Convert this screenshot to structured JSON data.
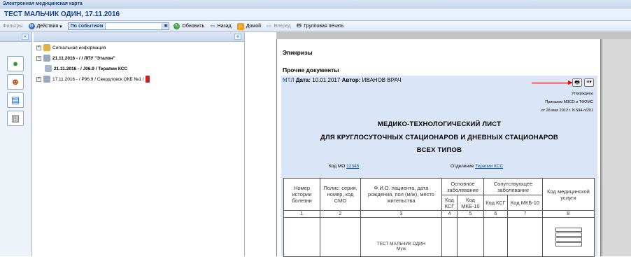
{
  "app": {
    "title": "Электронная медицинская карта",
    "patient_header": "ТЕСТ МАЛЬЧИК ОДИН, 17.11.2016"
  },
  "toolbar": {
    "filters": "Фильтры",
    "actions": "Действия",
    "by_events": "По событиям",
    "refresh": "Обновить",
    "back": "Назад",
    "home": "Домой",
    "forward": "Вперед",
    "group_print": "Групповая печать",
    "collapse": "«"
  },
  "sidebar": {
    "icons": [
      "person-icon",
      "doctors-icon",
      "monitor-icon",
      "book-icon"
    ]
  },
  "tree": {
    "items": [
      {
        "label": "Сигнальная информация"
      },
      {
        "label": "21.11.2016 - / / ЛПУ \"Эталон\""
      },
      {
        "label": "21.11.2016 - / J06.9 / Терапии КСС"
      },
      {
        "label": "17.11.2016 - / P96.9 / Свердловск ОКБ №1 /"
      }
    ]
  },
  "document": {
    "section_epicrises": "Эпикризы",
    "section_other": "Прочие документы",
    "doc_type": "МТЛ",
    "date_label": "Дата:",
    "date_value": "10.01.2017",
    "author_label": "Автор:",
    "author_value": "ИВАНОВ ВРАЧ",
    "approved": "Утверждена",
    "order": "Приказом МЗСО и ТФОМС",
    "order_date": "от 28 мая 2012 г. N 594-п/201",
    "title_line1": "МЕДИКО-ТЕХНОЛОГИЧЕСКИЙ ЛИСТ",
    "title_line2": "ДЛЯ КРУГЛОСУТОЧНЫХ СТАЦИОНАРОВ И ДНЕВНЫХ СТАЦИОНАРОВ",
    "title_line3": "ВСЕХ ТИПОВ",
    "mo_code_label": "Код МО",
    "mo_code_value": "12345",
    "department_label": "Отделение",
    "department_value": "Терапии КСС"
  },
  "table": {
    "headers": {
      "history_no": "Номер истории болезни",
      "policy": "Полис: серия, номер, код СМО",
      "patient": "Ф.И.О. пациента, дата рождения, пол (м/ж), место жительства",
      "main_disease": "Основное заболевание",
      "concomitant": "Сопутствующее заболевание",
      "service_code": "Код медицинской услуги",
      "ksg": "Код КСГ",
      "mkb": "Код МКБ-10",
      "ksg2": "Код КСГ",
      "mkb2": "Код МКБ-10"
    },
    "column_numbers": [
      "1",
      "2",
      "3",
      "4",
      "5",
      "6",
      "7",
      "8"
    ],
    "row": {
      "patient_name": "ТЕСТ МАЛЬЧИК ОДИН",
      "sex": "Муж"
    }
  }
}
